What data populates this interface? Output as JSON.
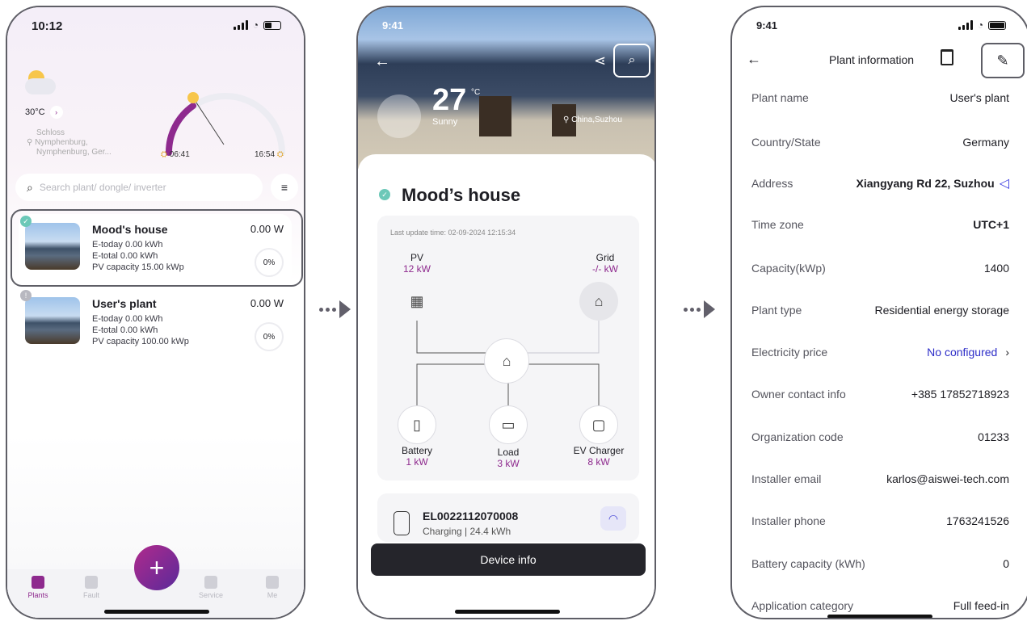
{
  "screen1": {
    "status_time": "10:12",
    "weather_temp": "30°C",
    "location_lines": [
      "Schloss",
      "Nymphenburg,",
      "Nymphenburg, Ger..."
    ],
    "sunrise": "06:41",
    "sunset": "16:54",
    "search_placeholder": "Search plant/ dongle/ inverter",
    "plants": [
      {
        "name": "Mood's house",
        "etoday": "E-today 0.00 kWh",
        "etotal": "E-total 0.00 kWh",
        "capacity": "PV capacity 15.00 kWp",
        "power": "0.00 W",
        "percent": "0%"
      },
      {
        "name": "User's plant",
        "etoday": "E-today 0.00 kWh",
        "etotal": "E-total 0.00 kWh",
        "capacity": "PV capacity 100.00 kWp",
        "power": "0.00 W",
        "percent": "0%"
      }
    ],
    "tabs": [
      "Plants",
      "Fault",
      "Service",
      "Me"
    ],
    "fab_label": "+",
    "accent": "#8e2a8e"
  },
  "screen2": {
    "status_time": "9:41",
    "temperature": "27",
    "temp_unit": "°C",
    "weather": "Sunny",
    "location": "China,Suzhou",
    "house_name": "Mood’s house",
    "last_update": "Last update time: 02-09-2024 12:15:34",
    "pv": {
      "label": "PV",
      "value": "12 kW"
    },
    "grid": {
      "label": "Grid",
      "value": "-/- kW"
    },
    "battery": {
      "label": "Battery",
      "value": "1 kW"
    },
    "load": {
      "label": "Load",
      "value": "3 kW"
    },
    "ev": {
      "label": "EV Charger",
      "value": "8 kW"
    },
    "device_id": "EL0022112070008",
    "device_status": "Charging | 24.4 kWh",
    "device_button": "Device info"
  },
  "screen3": {
    "status_time": "9:41",
    "title": "Plant information",
    "rows": [
      {
        "key": "Plant name",
        "value": "User's plant"
      },
      {
        "key": "Country/State",
        "value": "Germany"
      },
      {
        "key": "Address",
        "value": "Xiangyang Rd 22, Suzhou"
      },
      {
        "key": "Time zone",
        "value": "UTC+1"
      },
      {
        "key": "Capacity(kWp)",
        "value": "1400"
      },
      {
        "key": "Plant type",
        "value": "Residential energy storage"
      },
      {
        "key": "Electricity price",
        "value": "No configured"
      },
      {
        "key": "Owner contact info",
        "value": "+385 17852718923"
      },
      {
        "key": "Organization code",
        "value": "01233"
      },
      {
        "key": "Installer email",
        "value": "karlos@aiswei-tech.com"
      },
      {
        "key": "Installer phone",
        "value": "1763241526"
      },
      {
        "key": "Battery capacity (kWh)",
        "value": "0"
      },
      {
        "key": "Application category",
        "value": "Full feed-in"
      }
    ]
  }
}
